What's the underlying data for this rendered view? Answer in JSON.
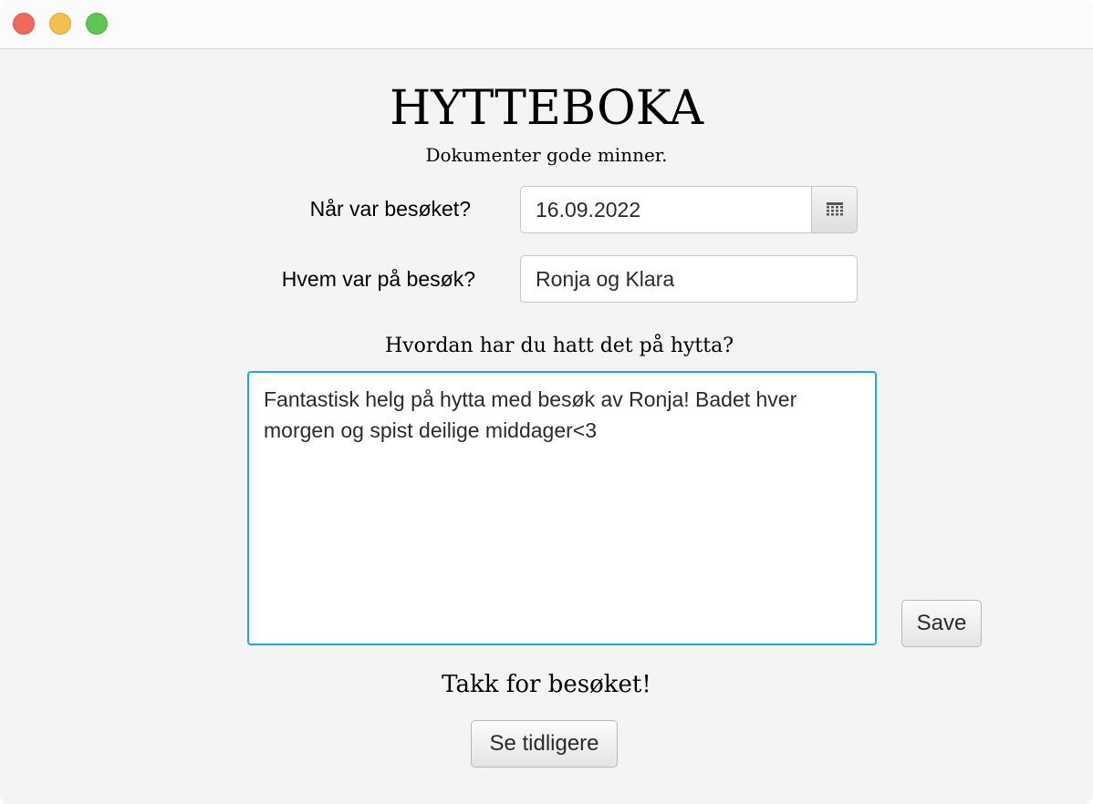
{
  "app": {
    "title": "HYTTEBOKA",
    "subtitle": "Dokumenter gode minner."
  },
  "form": {
    "date_label": "Når var besøket?",
    "date_value": "16.09.2022",
    "date_picker_icon": "calendar-icon",
    "who_label": "Hvem var på besøk?",
    "who_value": "Ronja og Klara",
    "question_label": "Hvordan har du hatt det på hytta?",
    "entry_text": "Fantastisk helg på hytta med besøk av Ronja! Badet hver morgen og spist deilige middager<3"
  },
  "actions": {
    "save_label": "Save",
    "thanks_text": "Takk for besøket!",
    "previous_label": "Se tidligere"
  },
  "colors": {
    "focus_border": "#24a5e4",
    "window_bg": "#f4f4f4",
    "close": "#ee6a5e",
    "minimize": "#f5bf4f",
    "maximize": "#61c554"
  }
}
